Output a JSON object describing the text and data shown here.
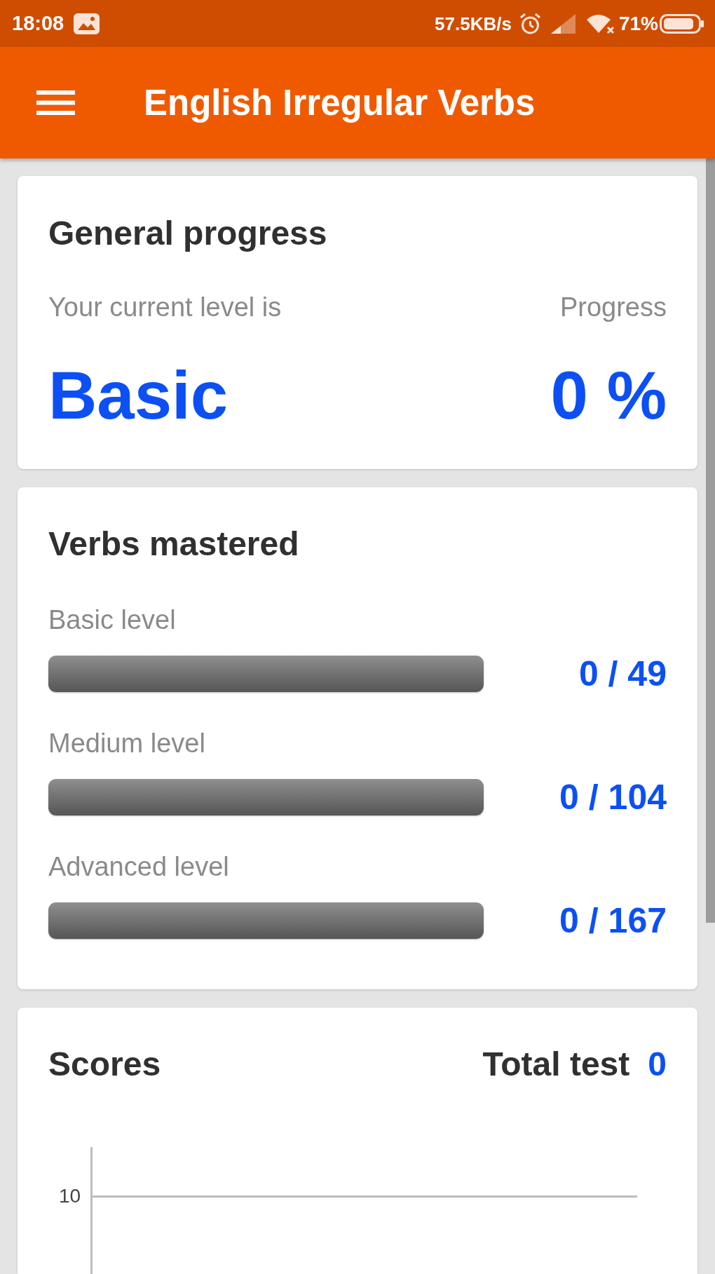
{
  "status_bar": {
    "time": "18:08",
    "network_speed": "57.5KB/s",
    "battery": "71%"
  },
  "app_bar": {
    "title": "English Irregular Verbs"
  },
  "general_progress": {
    "title": "General progress",
    "level_caption": "Your current level is",
    "current_level": "Basic",
    "progress_caption": "Progress",
    "progress_value": "0 %"
  },
  "verbs_mastered": {
    "title": "Verbs mastered",
    "rows": [
      {
        "label": "Basic level",
        "level": 0,
        "count": "0 / 49"
      },
      {
        "label": "Medium level",
        "level": 0,
        "count": "0 / 104"
      },
      {
        "label": "Advanced level",
        "level": 0,
        "count": "0 / 167"
      }
    ]
  },
  "scores": {
    "title": "Scores",
    "total_label": "Total test",
    "total_value": "0",
    "chart": {
      "y_tick_labels": [
        "10"
      ]
    }
  }
}
